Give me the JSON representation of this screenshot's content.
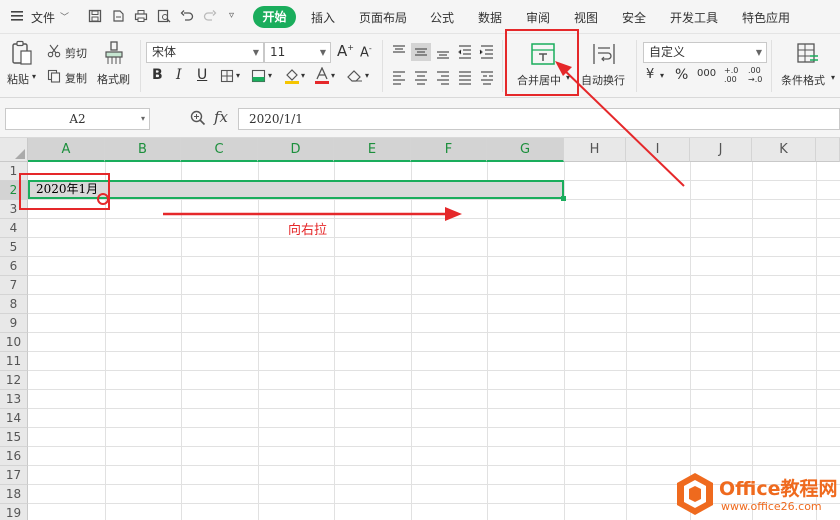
{
  "menubar": {
    "file_label": "文件",
    "tabs": [
      "开始",
      "插入",
      "页面布局",
      "公式",
      "数据",
      "审阅",
      "视图",
      "安全",
      "开发工具",
      "特色应用"
    ],
    "accent": "#1aad5c"
  },
  "ribbon": {
    "paste_label": "粘贴",
    "cut_label": "剪切",
    "copy_label": "复制",
    "format_painter_label": "格式刷",
    "font_name": "宋体",
    "font_size": "11",
    "bold_label": "B",
    "italic_label": "I",
    "underline_label": "U",
    "merge_center_label": "合并居中",
    "wrap_text_label": "自动换行",
    "number_format": "自定义",
    "conditional_format_label": "条件格式",
    "percent_label": "%",
    "thousands_label": "000"
  },
  "formula_bar": {
    "cell_ref": "A2",
    "fx_label": "fx",
    "value": "2020/1/1"
  },
  "sheet": {
    "columns": [
      "A",
      "B",
      "C",
      "D",
      "E",
      "F",
      "G",
      "H",
      "I",
      "J",
      "K"
    ],
    "rows": [
      "1",
      "2",
      "3",
      "4",
      "5",
      "6",
      "7",
      "8",
      "9",
      "10",
      "11",
      "12",
      "13",
      "14",
      "15",
      "16",
      "17",
      "18",
      "19"
    ],
    "cell_a2": "2020年1月",
    "selection_color": "#1aad5c"
  },
  "annotation": {
    "drag_hint": "向右拉",
    "color": "#e5282a"
  },
  "watermark": {
    "brand": "Office教程网",
    "url": "www.office26.com"
  }
}
